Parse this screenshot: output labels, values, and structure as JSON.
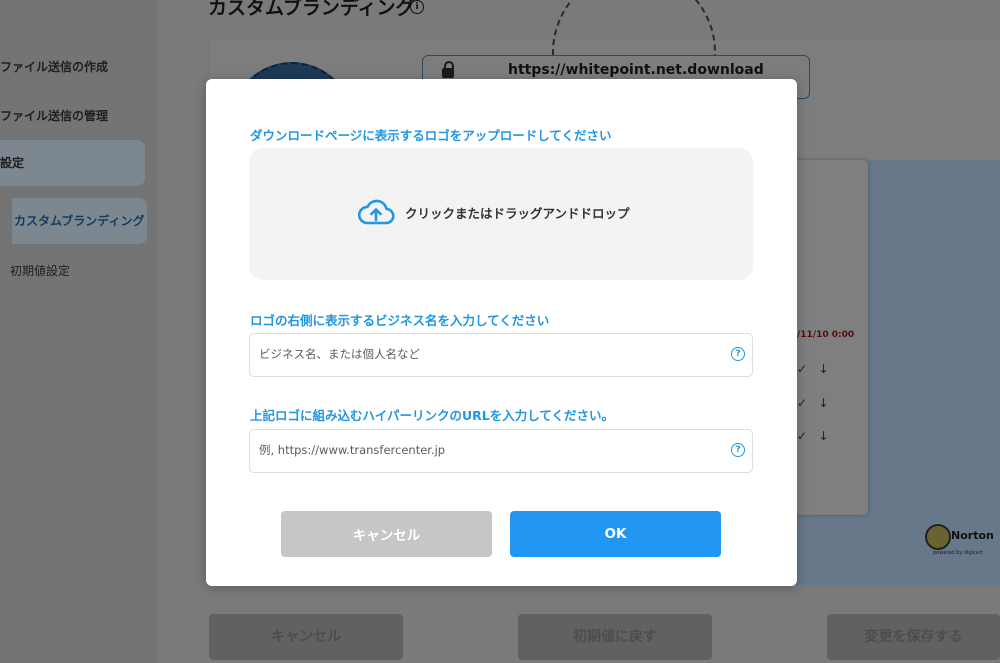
{
  "background": {
    "sidebar": {
      "items": [
        {
          "label": "ファイル送信の作成"
        },
        {
          "label": "ファイル送信の管理"
        },
        {
          "label": "設定"
        },
        {
          "label": "カスタムブランディング"
        },
        {
          "label": "初期値設定"
        }
      ]
    },
    "page_title": "カスタムブランディング",
    "url_preview": "https://whitepoint.net.download",
    "card_date": "/11/10 0:00",
    "norton": {
      "name": "Norton",
      "sub": "powered by digicert"
    },
    "buttons": {
      "cancel": "キャンセル",
      "reset": "初期値に戻す",
      "save": "変更を保存する"
    }
  },
  "modal": {
    "logo_section_label": "ダウンロードページに表示するロゴをアップロードしてください",
    "dropzone_text": "クリックまたはドラッグアンドドロップ",
    "business_section_label": "ロゴの右側に表示するビジネス名を入力してください",
    "business_placeholder": "ビジネス名、または個人名など",
    "business_value": "",
    "url_section_label": "上記ロゴに組み込むハイパーリンクのURLを入力してください。",
    "url_placeholder": "例, https://www.transfercenter.jp",
    "url_value": "",
    "cancel_label": "キャンセル",
    "ok_label": "OK"
  },
  "colors": {
    "accent": "#2196f3",
    "label_blue": "#2196e3",
    "cancel_gray": "#c6c6c6",
    "overlay": "#777777"
  }
}
